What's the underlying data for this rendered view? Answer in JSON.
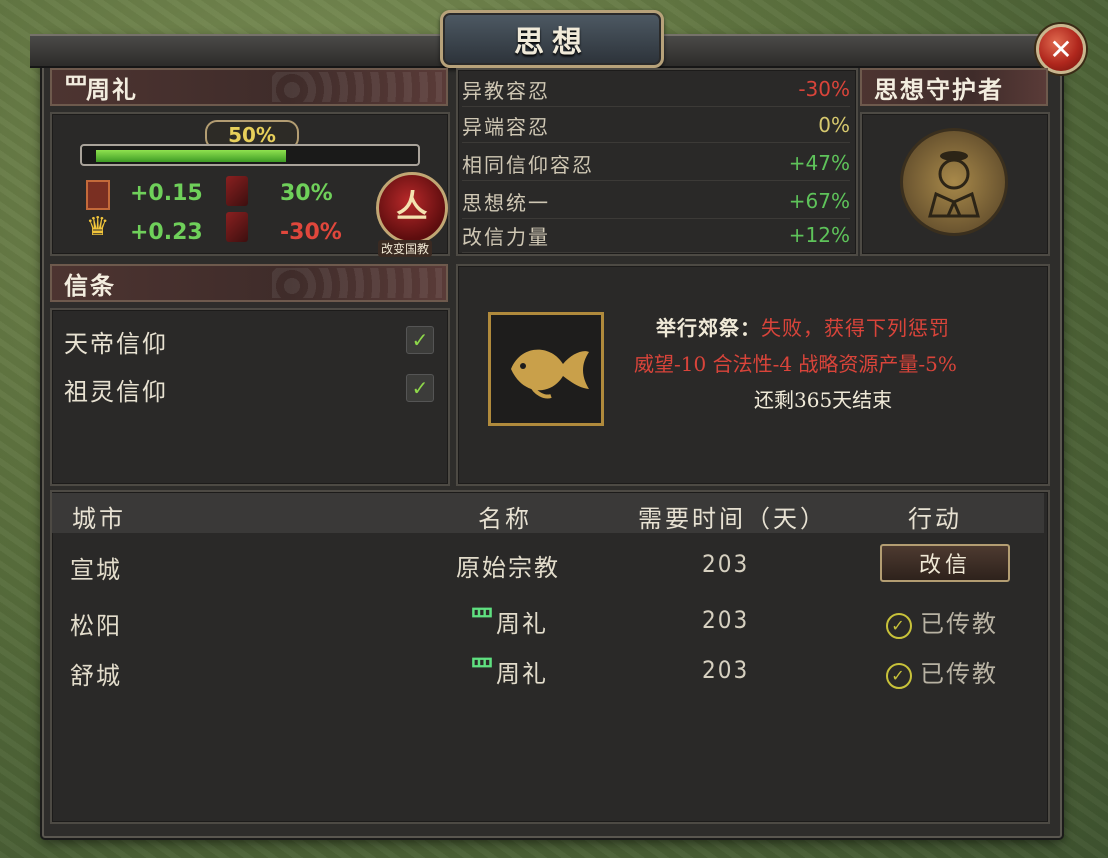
{
  "window": {
    "title": "思想"
  },
  "religion": {
    "name": "周礼",
    "icon": "zhou-li-icon",
    "progress_label": "50%",
    "progress": 0.5,
    "stats": [
      {
        "icon": "book-icon",
        "value": "+0.15",
        "icon2": "scroll-icon",
        "value2": "30%"
      },
      {
        "icon": "crown-icon",
        "value": "+0.23",
        "icon2": "scroll-icon",
        "value2": "-30%"
      }
    ],
    "change_button": "改变国教"
  },
  "tolerances": [
    {
      "label": "异教容忍",
      "value": "-30%",
      "tone": "neg"
    },
    {
      "label": "异端容忍",
      "value": "0%",
      "tone": "neu"
    },
    {
      "label": "相同信仰容忍",
      "value": "+47%",
      "tone": "pos"
    },
    {
      "label": "思想统一",
      "value": "+67%",
      "tone": "pos"
    },
    {
      "label": "改信力量",
      "value": "+12%",
      "tone": "pos"
    }
  ],
  "guardian": {
    "title": "思想守护者",
    "icon": "scholar-icon"
  },
  "doctrines": {
    "title": "信条",
    "items": [
      {
        "label": "天帝信仰",
        "checked": true
      },
      {
        "label": "祖灵信仰",
        "checked": true
      }
    ]
  },
  "event": {
    "icon": "koi-fish-icon",
    "line1_prefix": "举行郊祭：",
    "line1_result": "失败，获得下列惩罚",
    "line2": "威望-10 合法性-4 战略资源产量-5%",
    "line3": "还剩365天结束"
  },
  "table": {
    "headers": [
      "城市",
      "名称",
      "需要时间（天）",
      "行动"
    ],
    "rows": [
      {
        "city": "宣城",
        "name": "原始宗教",
        "time": "203",
        "action": "改信",
        "state": "button"
      },
      {
        "city": "松阳",
        "name": "周礼",
        "time": "203",
        "action": "已传教",
        "state": "done"
      },
      {
        "city": "舒城",
        "name": "周礼",
        "time": "203",
        "action": "已传教",
        "state": "done"
      }
    ]
  },
  "colors": {
    "negative": "#d9443a",
    "positive": "#5ec35a",
    "neutral": "#d6c86e",
    "accent_gold": "#b7a27a"
  }
}
